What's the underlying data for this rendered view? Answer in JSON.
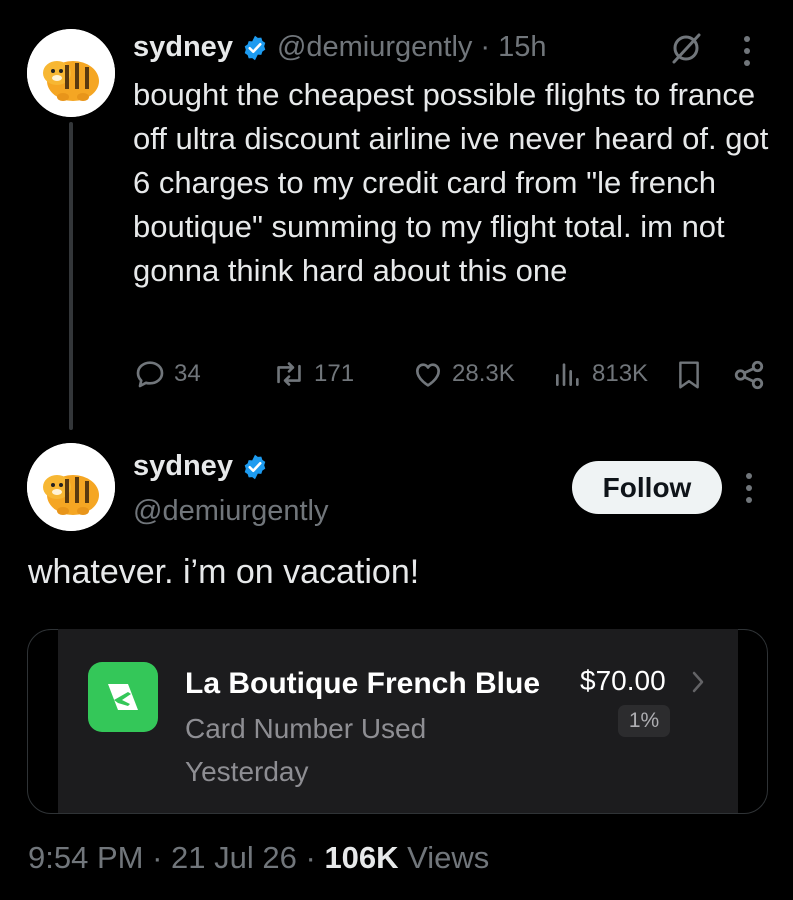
{
  "post1": {
    "author_name": "sydney",
    "handle": "@demiurgently",
    "separator": "·",
    "time_ago": "15h",
    "text": "bought the cheapest possible flights to france off ultra discount airline ive never heard of. got 6 charges to my credit card from \"le french boutique\" summing to my flight total. im not gonna think hard about this one",
    "actions": {
      "replies": "34",
      "reposts": "171",
      "likes": "28.3K",
      "views": "813K"
    }
  },
  "post2": {
    "author_name": "sydney",
    "handle": "@demiurgently",
    "follow_label": "Follow",
    "text": "whatever. i’m on vacation!",
    "transaction": {
      "merchant": "La Boutique French Blue",
      "amount": "$70.00",
      "cashback": "1%",
      "method": "Card Number Used",
      "date": "Yesterday"
    },
    "footer": {
      "time": "9:54 PM",
      "sep1": "·",
      "date": "21 Jul 26",
      "sep2": "·",
      "views_count": "106K",
      "views_label": "Views"
    }
  },
  "icons": {
    "verified": "verified-badge-icon",
    "grok": "grok-icon",
    "more": "more-dots-icon",
    "reply": "reply-icon",
    "repost": "repost-icon",
    "like": "heart-icon",
    "views": "views-chart-icon",
    "bookmark": "bookmark-icon",
    "share": "share-icon",
    "chevron": "chevron-right-icon",
    "airline": "airline-logo-icon"
  },
  "colors": {
    "background": "#000000",
    "text": "#e7e9ea",
    "muted": "#71767b",
    "verified": "#1d9bf0",
    "app_green": "#34c759",
    "card_bg": "#1c1c1e"
  }
}
